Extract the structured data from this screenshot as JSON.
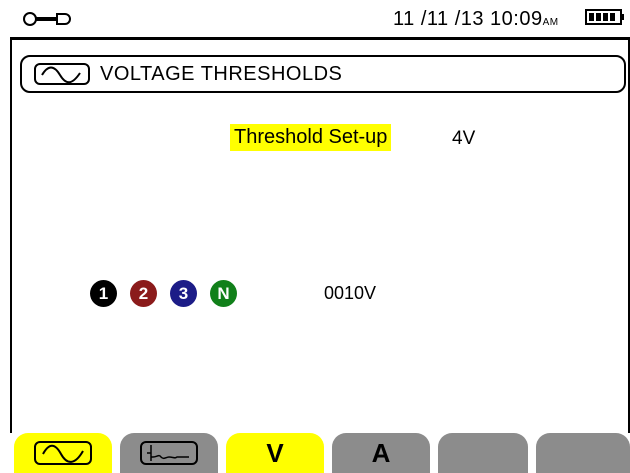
{
  "status_bar": {
    "datetime": "11 /11 /13  10:09",
    "ampm": "AM",
    "wrench_icon": "wrench-icon",
    "battery_icon": "battery-full-icon"
  },
  "title": {
    "icon": "waveform-icon",
    "text": "VOLTAGE THRESHOLDS"
  },
  "threshold": {
    "label": "Threshold Set-up",
    "value": "4V"
  },
  "phases": {
    "labels": [
      "1",
      "2",
      "3",
      "N"
    ],
    "colors": [
      "#000000",
      "#8b1b1b",
      "#1c1c87",
      "#11801a"
    ],
    "value": "0010V"
  },
  "tabs": [
    {
      "icon": "waveform-icon",
      "selected": true
    },
    {
      "icon": "transient-icon",
      "selected": false
    },
    {
      "label": "V",
      "selected": true
    },
    {
      "label": "A",
      "selected": false
    },
    {
      "label": "",
      "selected": false
    },
    {
      "label": "",
      "selected": false
    }
  ],
  "colors": {
    "highlight": "#ffff00",
    "tab_inactive": "#8c8c8c"
  }
}
